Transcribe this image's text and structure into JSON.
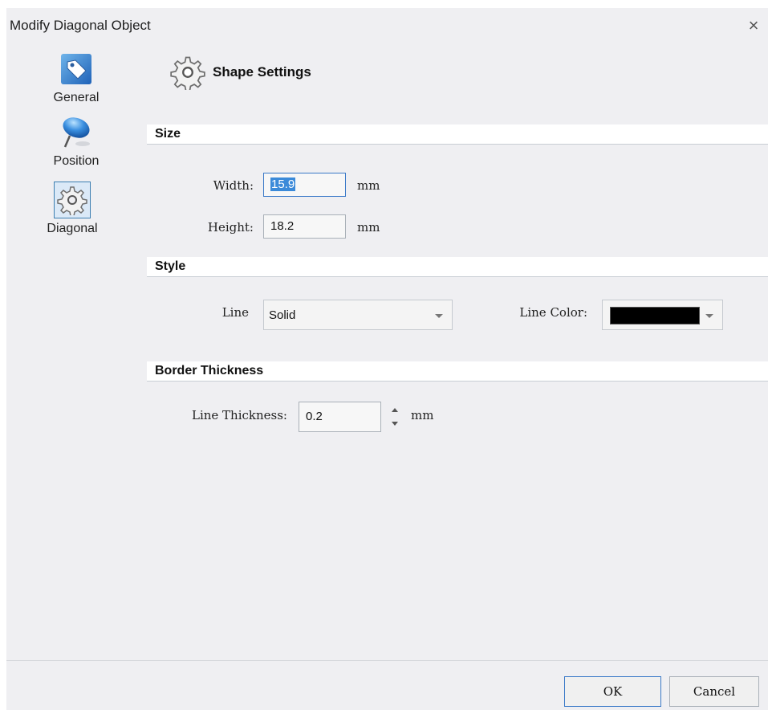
{
  "window": {
    "title": "Modify Diagonal Object",
    "close_symbol": "×"
  },
  "sidebar": {
    "items": [
      {
        "label": "General",
        "icon": "tag-icon",
        "selected": false
      },
      {
        "label": "Position",
        "icon": "pushpin-icon",
        "selected": false
      },
      {
        "label": "Diagonal",
        "icon": "gear-icon",
        "selected": true
      }
    ]
  },
  "header": {
    "title": "Shape Settings",
    "icon": "gear-icon"
  },
  "sections": {
    "size": {
      "label": "Size",
      "width_label": "Width:",
      "width_value": "15.9",
      "width_unit": "mm",
      "height_label": "Height:",
      "height_value": "18.2",
      "height_unit": "mm"
    },
    "style": {
      "label": "Style",
      "line_label": "Line",
      "line_value": "Solid",
      "line_color_label": "Line Color:",
      "line_color": "#000000"
    },
    "border": {
      "label": "Border Thickness",
      "thickness_label": "Line Thickness:",
      "thickness_value": "0.2",
      "thickness_unit": "mm"
    }
  },
  "footer": {
    "ok_label": "OK",
    "cancel_label": "Cancel"
  },
  "colors": {
    "accent": "#3a79c8",
    "background": "#efeff2"
  }
}
